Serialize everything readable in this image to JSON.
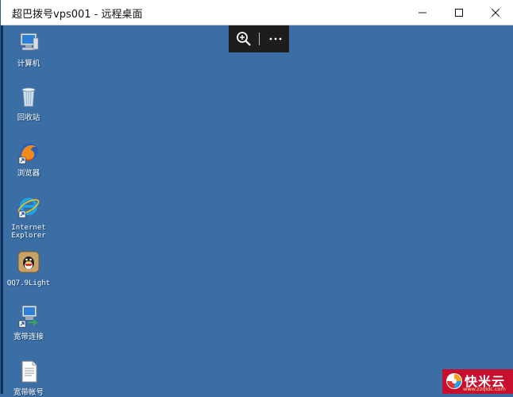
{
  "window": {
    "title": "超巴拨号vps001 - 远程桌面",
    "buttons": [
      "minimize",
      "maximize",
      "close"
    ]
  },
  "rdp_toolbar": {
    "zoom_icon": "zoom-in-icon",
    "more_icon": "more-icon"
  },
  "desktop": {
    "background_color": "#3a6ea5",
    "icons": [
      {
        "label": "计算机",
        "icon": "computer-icon"
      },
      {
        "label": "回收站",
        "icon": "recycle-bin-icon"
      },
      {
        "label": "浏览器",
        "icon": "firefox-icon"
      },
      {
        "label": "Internet Explorer",
        "label_line1": "Internet",
        "label_line2": "Explorer",
        "icon": "internet-explorer-icon"
      },
      {
        "label": "QQ7.9Light",
        "icon": "qq-icon"
      },
      {
        "label": "宽带连接",
        "icon": "broadband-connection-icon"
      },
      {
        "label": "宽带帐号",
        "icon": "text-file-icon"
      }
    ]
  },
  "watermark": {
    "brand": "快米云",
    "url": "www.zzqidc.com"
  }
}
